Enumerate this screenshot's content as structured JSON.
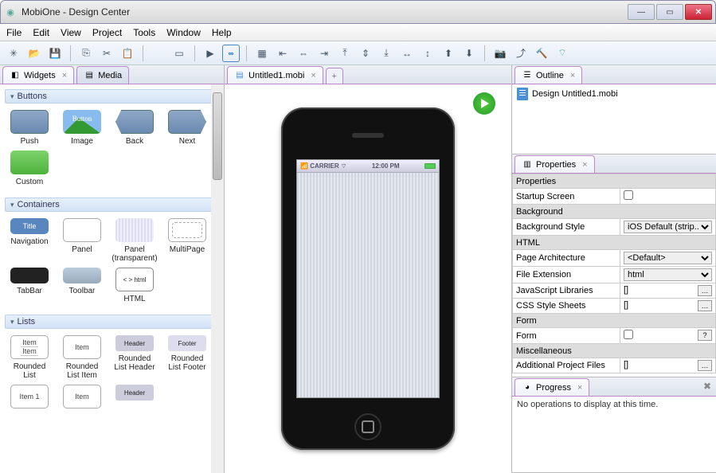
{
  "window": {
    "title": "MobiOne - Design Center"
  },
  "menu": [
    "File",
    "Edit",
    "View",
    "Project",
    "Tools",
    "Window",
    "Help"
  ],
  "leftPanel": {
    "tabs": [
      "Widgets",
      "Media"
    ],
    "sections": {
      "buttons": "Buttons",
      "containers": "Containers",
      "lists": "Lists"
    },
    "widgets": {
      "push": "Push",
      "image": "Image",
      "back": "Back",
      "next": "Next",
      "custom": "Custom",
      "nav": "Navigation",
      "panel": "Panel",
      "panelT": "Panel (transparent)",
      "multi": "MultiPage",
      "tabbar": "TabBar",
      "toolbar": "Toolbar",
      "html": "HTML",
      "rlist": "Rounded List",
      "rlistitem": "Rounded List Item",
      "rlistheader": "Rounded List Header",
      "rlistfooter": "Rounded List Footer",
      "navLabel": "Title",
      "itemLabel": "Item",
      "headerLabel": "Header",
      "footerLabel": "Footer",
      "item1Label": "Item 1"
    }
  },
  "editor": {
    "tab": "Untitled1.mobi",
    "carrier": "CARRIER",
    "time": "12:00 PM"
  },
  "outline": {
    "title": "Outline",
    "item": "Design Untitled1.mobi"
  },
  "properties": {
    "title": "Properties",
    "cats": {
      "props": "Properties",
      "bg": "Background",
      "html": "HTML",
      "form": "Form",
      "misc": "Miscellaneous"
    },
    "rows": {
      "startup": "Startup Screen",
      "bgstyle": "Background Style",
      "bgstyle_v": "iOS Default (strip...",
      "arch": "Page Architecture",
      "arch_v": "<Default>",
      "ext": "File Extension",
      "ext_v": "html",
      "jslib": "JavaScript Libraries",
      "jslib_v": "[]",
      "css": "CSS Style Sheets",
      "css_v": "[]",
      "form": "Form",
      "addfiles": "Additional Project Files",
      "addfiles_v": "[]"
    }
  },
  "progress": {
    "title": "Progress",
    "msg": "No operations to display at this time."
  }
}
